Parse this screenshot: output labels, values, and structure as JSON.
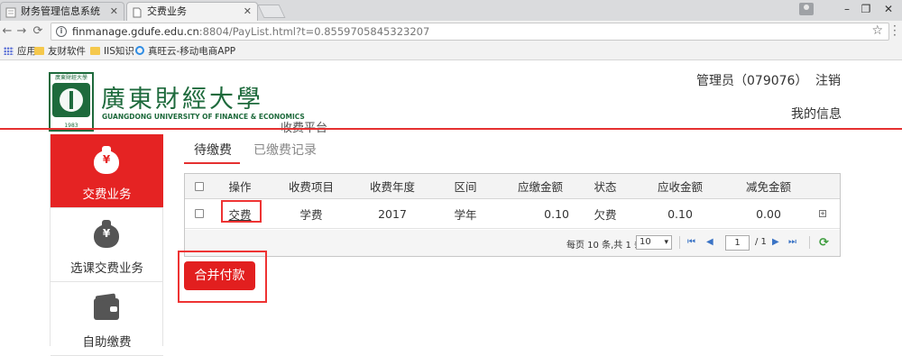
{
  "browser": {
    "tabs": [
      {
        "title": "财务管理信息系统",
        "active": false
      },
      {
        "title": "交费业务",
        "active": true
      }
    ],
    "window_controls": {
      "minimize": "–",
      "restore": "❐",
      "close": "✕"
    },
    "url_host": "finmanage.gdufe.edu.cn",
    "url_rest": ":8804/PayList.html?t=0.8559705845323207",
    "bookmarks": [
      {
        "label": "应用",
        "icon": "apps-icon"
      },
      {
        "label": "友财软件",
        "icon": "folder-icon"
      },
      {
        "label": "IIS知识",
        "icon": "folder-icon"
      },
      {
        "label": "真旺云-移动电商APP",
        "icon": "cloud-icon"
      }
    ]
  },
  "header": {
    "logo_top_text": "廣東財經大學",
    "logo_year": "1983",
    "logo_cn": "廣東財經大學",
    "logo_en": "GUANGDONG UNIVERSITY OF FINANCE & ECONOMICS",
    "platform": "收费平台",
    "admin_label": "管理员（079076）",
    "logout": "注销",
    "my_info": "我的信息",
    "accent_color": "#e53030",
    "brand_color": "#1e6a3c"
  },
  "sidebar": {
    "items": [
      {
        "label": "交费业务",
        "icon": "money-bag-icon",
        "glyph": "¥",
        "active": true
      },
      {
        "label": "选课交费业务",
        "icon": "money-bag-icon",
        "glyph": "¥",
        "active": false
      },
      {
        "label": "自助缴费",
        "icon": "wallet-icon",
        "active": false
      }
    ]
  },
  "tabs": [
    {
      "label": "待缴费",
      "active": true
    },
    {
      "label": "已缴费记录",
      "active": false
    }
  ],
  "grid": {
    "columns": [
      "操作",
      "收费项目",
      "收费年度",
      "区间",
      "应缴金额",
      "状态",
      "应收金额",
      "减免金额"
    ],
    "rows": [
      {
        "action": "交费",
        "item": "学费",
        "year": "2017",
        "period": "学年",
        "due": "0.10",
        "status": "欠费",
        "receivable": "0.10",
        "discount": "0.00"
      }
    ],
    "pager": {
      "summary_prefix": "每页 10 条,共 1 条",
      "page_size": "10",
      "page_value": "1",
      "page_total": "/ 1",
      "first": "⏮",
      "prev": "◀",
      "next": "▶",
      "last": "⏭",
      "refresh": "⟳"
    }
  },
  "merge_button": "合并付款"
}
